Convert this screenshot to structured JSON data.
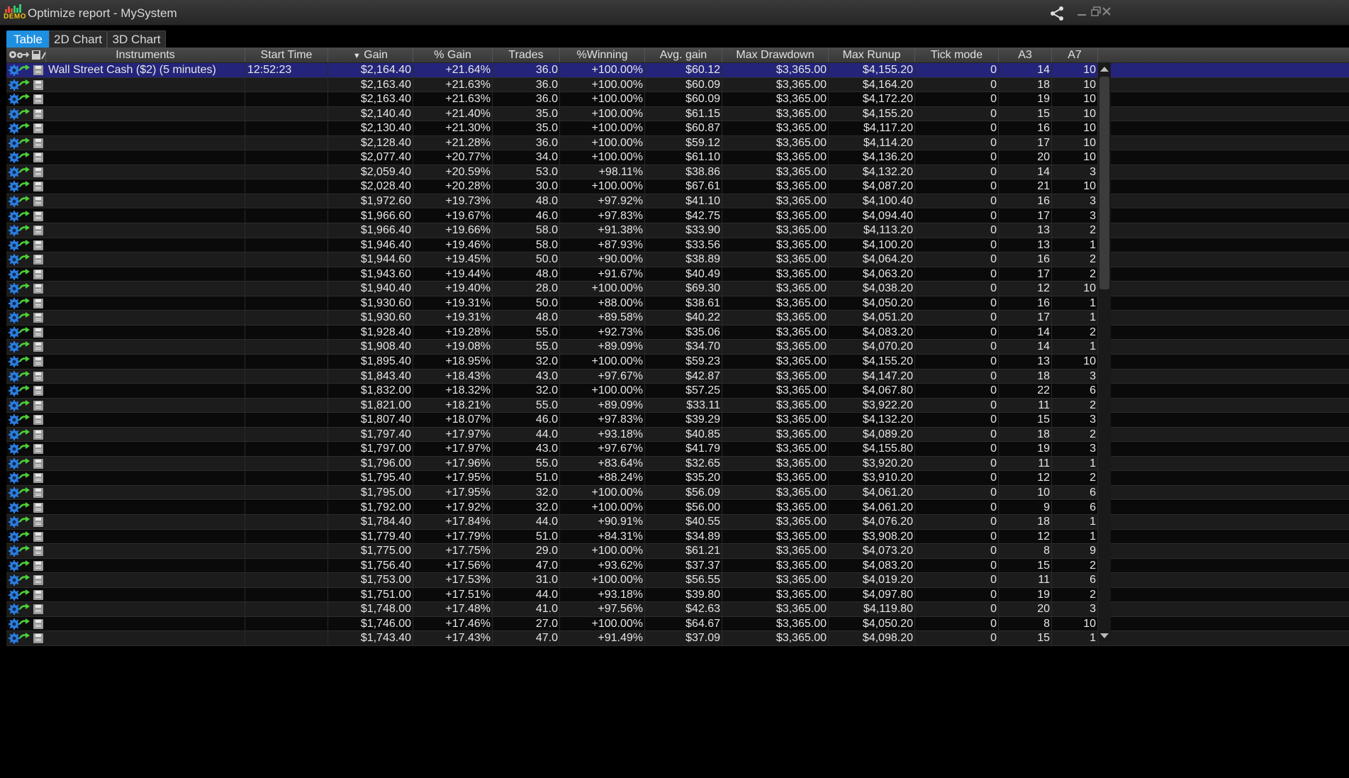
{
  "window": {
    "logo_text": "DEMO",
    "title": "Optimize report - MySystem"
  },
  "tabs": [
    {
      "label": "Table",
      "active": true
    },
    {
      "label": "2D Chart",
      "active": false
    },
    {
      "label": "3D Chart",
      "active": false
    }
  ],
  "colors": {
    "accent": "#1e8fe1",
    "selected_row": "#24247a",
    "row_odd": "#1c1c1c",
    "row_even": "#0a0a0a"
  },
  "columns": [
    {
      "key": "instruments",
      "label": "Instruments"
    },
    {
      "key": "start_time",
      "label": "Start Time"
    },
    {
      "key": "gain",
      "label": "Gain",
      "sorted": "desc"
    },
    {
      "key": "pct_gain",
      "label": "% Gain"
    },
    {
      "key": "trades",
      "label": "Trades"
    },
    {
      "key": "pct_winning",
      "label": "%Winning"
    },
    {
      "key": "avg_gain",
      "label": "Avg. gain"
    },
    {
      "key": "max_drawdown",
      "label": "Max Drawdown"
    },
    {
      "key": "max_runup",
      "label": "Max Runup"
    },
    {
      "key": "tick_mode",
      "label": "Tick mode"
    },
    {
      "key": "a3",
      "label": "A3"
    },
    {
      "key": "a7",
      "label": "A7"
    }
  ],
  "rows": [
    [
      "Wall Street Cash ($2) (5 minutes)",
      "12:52:23",
      "$2,164.40",
      "+21.64%",
      "36.0",
      "+100.00%",
      "$60.12",
      "$3,365.00",
      "$4,155.20",
      "0",
      "14",
      "10"
    ],
    [
      "",
      "",
      "$2,163.40",
      "+21.63%",
      "36.0",
      "+100.00%",
      "$60.09",
      "$3,365.00",
      "$4,164.20",
      "0",
      "18",
      "10"
    ],
    [
      "",
      "",
      "$2,163.40",
      "+21.63%",
      "36.0",
      "+100.00%",
      "$60.09",
      "$3,365.00",
      "$4,172.20",
      "0",
      "19",
      "10"
    ],
    [
      "",
      "",
      "$2,140.40",
      "+21.40%",
      "35.0",
      "+100.00%",
      "$61.15",
      "$3,365.00",
      "$4,155.20",
      "0",
      "15",
      "10"
    ],
    [
      "",
      "",
      "$2,130.40",
      "+21.30%",
      "35.0",
      "+100.00%",
      "$60.87",
      "$3,365.00",
      "$4,117.20",
      "0",
      "16",
      "10"
    ],
    [
      "",
      "",
      "$2,128.40",
      "+21.28%",
      "36.0",
      "+100.00%",
      "$59.12",
      "$3,365.00",
      "$4,114.20",
      "0",
      "17",
      "10"
    ],
    [
      "",
      "",
      "$2,077.40",
      "+20.77%",
      "34.0",
      "+100.00%",
      "$61.10",
      "$3,365.00",
      "$4,136.20",
      "0",
      "20",
      "10"
    ],
    [
      "",
      "",
      "$2,059.40",
      "+20.59%",
      "53.0",
      "+98.11%",
      "$38.86",
      "$3,365.00",
      "$4,132.20",
      "0",
      "14",
      "3"
    ],
    [
      "",
      "",
      "$2,028.40",
      "+20.28%",
      "30.0",
      "+100.00%",
      "$67.61",
      "$3,365.00",
      "$4,087.20",
      "0",
      "21",
      "10"
    ],
    [
      "",
      "",
      "$1,972.60",
      "+19.73%",
      "48.0",
      "+97.92%",
      "$41.10",
      "$3,365.00",
      "$4,100.40",
      "0",
      "16",
      "3"
    ],
    [
      "",
      "",
      "$1,966.60",
      "+19.67%",
      "46.0",
      "+97.83%",
      "$42.75",
      "$3,365.00",
      "$4,094.40",
      "0",
      "17",
      "3"
    ],
    [
      "",
      "",
      "$1,966.40",
      "+19.66%",
      "58.0",
      "+91.38%",
      "$33.90",
      "$3,365.00",
      "$4,113.20",
      "0",
      "13",
      "2"
    ],
    [
      "",
      "",
      "$1,946.40",
      "+19.46%",
      "58.0",
      "+87.93%",
      "$33.56",
      "$3,365.00",
      "$4,100.20",
      "0",
      "13",
      "1"
    ],
    [
      "",
      "",
      "$1,944.60",
      "+19.45%",
      "50.0",
      "+90.00%",
      "$38.89",
      "$3,365.00",
      "$4,064.20",
      "0",
      "16",
      "2"
    ],
    [
      "",
      "",
      "$1,943.60",
      "+19.44%",
      "48.0",
      "+91.67%",
      "$40.49",
      "$3,365.00",
      "$4,063.20",
      "0",
      "17",
      "2"
    ],
    [
      "",
      "",
      "$1,940.40",
      "+19.40%",
      "28.0",
      "+100.00%",
      "$69.30",
      "$3,365.00",
      "$4,038.20",
      "0",
      "12",
      "10"
    ],
    [
      "",
      "",
      "$1,930.60",
      "+19.31%",
      "50.0",
      "+88.00%",
      "$38.61",
      "$3,365.00",
      "$4,050.20",
      "0",
      "16",
      "1"
    ],
    [
      "",
      "",
      "$1,930.60",
      "+19.31%",
      "48.0",
      "+89.58%",
      "$40.22",
      "$3,365.00",
      "$4,051.20",
      "0",
      "17",
      "1"
    ],
    [
      "",
      "",
      "$1,928.40",
      "+19.28%",
      "55.0",
      "+92.73%",
      "$35.06",
      "$3,365.00",
      "$4,083.20",
      "0",
      "14",
      "2"
    ],
    [
      "",
      "",
      "$1,908.40",
      "+19.08%",
      "55.0",
      "+89.09%",
      "$34.70",
      "$3,365.00",
      "$4,070.20",
      "0",
      "14",
      "1"
    ],
    [
      "",
      "",
      "$1,895.40",
      "+18.95%",
      "32.0",
      "+100.00%",
      "$59.23",
      "$3,365.00",
      "$4,155.20",
      "0",
      "13",
      "10"
    ],
    [
      "",
      "",
      "$1,843.40",
      "+18.43%",
      "43.0",
      "+97.67%",
      "$42.87",
      "$3,365.00",
      "$4,147.20",
      "0",
      "18",
      "3"
    ],
    [
      "",
      "",
      "$1,832.00",
      "+18.32%",
      "32.0",
      "+100.00%",
      "$57.25",
      "$3,365.00",
      "$4,067.80",
      "0",
      "22",
      "6"
    ],
    [
      "",
      "",
      "$1,821.00",
      "+18.21%",
      "55.0",
      "+89.09%",
      "$33.11",
      "$3,365.00",
      "$3,922.20",
      "0",
      "11",
      "2"
    ],
    [
      "",
      "",
      "$1,807.40",
      "+18.07%",
      "46.0",
      "+97.83%",
      "$39.29",
      "$3,365.00",
      "$4,132.20",
      "0",
      "15",
      "3"
    ],
    [
      "",
      "",
      "$1,797.40",
      "+17.97%",
      "44.0",
      "+93.18%",
      "$40.85",
      "$3,365.00",
      "$4,089.20",
      "0",
      "18",
      "2"
    ],
    [
      "",
      "",
      "$1,797.00",
      "+17.97%",
      "43.0",
      "+97.67%",
      "$41.79",
      "$3,365.00",
      "$4,155.80",
      "0",
      "19",
      "3"
    ],
    [
      "",
      "",
      "$1,796.00",
      "+17.96%",
      "55.0",
      "+83.64%",
      "$32.65",
      "$3,365.00",
      "$3,920.20",
      "0",
      "11",
      "1"
    ],
    [
      "",
      "",
      "$1,795.40",
      "+17.95%",
      "51.0",
      "+88.24%",
      "$35.20",
      "$3,365.00",
      "$3,910.20",
      "0",
      "12",
      "2"
    ],
    [
      "",
      "",
      "$1,795.00",
      "+17.95%",
      "32.0",
      "+100.00%",
      "$56.09",
      "$3,365.00",
      "$4,061.20",
      "0",
      "10",
      "6"
    ],
    [
      "",
      "",
      "$1,792.00",
      "+17.92%",
      "32.0",
      "+100.00%",
      "$56.00",
      "$3,365.00",
      "$4,061.20",
      "0",
      "9",
      "6"
    ],
    [
      "",
      "",
      "$1,784.40",
      "+17.84%",
      "44.0",
      "+90.91%",
      "$40.55",
      "$3,365.00",
      "$4,076.20",
      "0",
      "18",
      "1"
    ],
    [
      "",
      "",
      "$1,779.40",
      "+17.79%",
      "51.0",
      "+84.31%",
      "$34.89",
      "$3,365.00",
      "$3,908.20",
      "0",
      "12",
      "1"
    ],
    [
      "",
      "",
      "$1,775.00",
      "+17.75%",
      "29.0",
      "+100.00%",
      "$61.21",
      "$3,365.00",
      "$4,073.20",
      "0",
      "8",
      "9"
    ],
    [
      "",
      "",
      "$1,756.40",
      "+17.56%",
      "47.0",
      "+93.62%",
      "$37.37",
      "$3,365.00",
      "$4,083.20",
      "0",
      "15",
      "2"
    ],
    [
      "",
      "",
      "$1,753.00",
      "+17.53%",
      "31.0",
      "+100.00%",
      "$56.55",
      "$3,365.00",
      "$4,019.20",
      "0",
      "11",
      "6"
    ],
    [
      "",
      "",
      "$1,751.00",
      "+17.51%",
      "44.0",
      "+93.18%",
      "$39.80",
      "$3,365.00",
      "$4,097.80",
      "0",
      "19",
      "2"
    ],
    [
      "",
      "",
      "$1,748.00",
      "+17.48%",
      "41.0",
      "+97.56%",
      "$42.63",
      "$3,365.00",
      "$4,119.80",
      "0",
      "20",
      "3"
    ],
    [
      "",
      "",
      "$1,746.00",
      "+17.46%",
      "27.0",
      "+100.00%",
      "$64.67",
      "$3,365.00",
      "$4,050.20",
      "0",
      "8",
      "10"
    ],
    [
      "",
      "",
      "$1,743.40",
      "+17.43%",
      "47.0",
      "+91.49%",
      "$37.09",
      "$3,365.00",
      "$4,098.20",
      "0",
      "15",
      "1"
    ]
  ]
}
